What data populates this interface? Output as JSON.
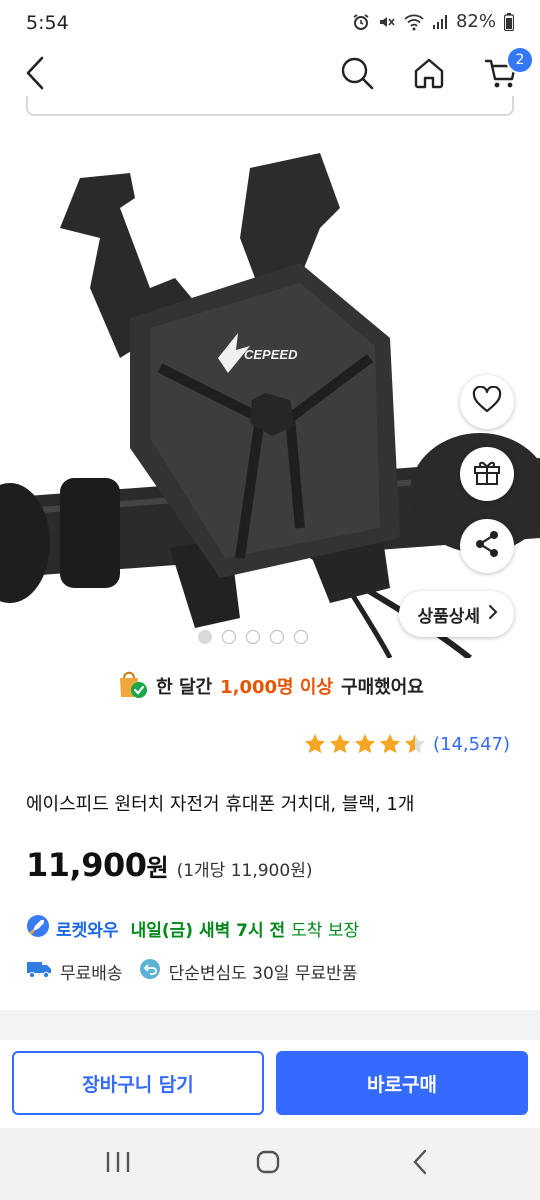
{
  "status": {
    "time": "5:54",
    "battery": "82%"
  },
  "nav": {
    "cart_count": "2"
  },
  "product": {
    "brand_logo_text": "CEPEED",
    "image_dots": 5,
    "detail_button_label": "상품상세",
    "purchase_note": {
      "prefix": "한 달간",
      "highlight": "1,000명 이상",
      "suffix": "구매했어요"
    },
    "rating": 4.5,
    "review_count": "(14,547)",
    "title": "에이스피드 원터치 자전거 휴대폰 거치대, 블랙, 1개",
    "price": "11,900",
    "price_unit": "원",
    "unit_price": "(1개당 11,900원)",
    "delivery": {
      "rocket_label": "로켓와우",
      "date_text": "내일(금) 새벽 7시 전",
      "guarantee": "도착 보장"
    },
    "perks": {
      "free_shipping": "무료배송",
      "returns": "단순변심도 30일 무료반품"
    }
  },
  "actions": {
    "add_to_cart": "장바구니 담기",
    "buy_now": "바로구매"
  },
  "colors": {
    "accent_blue": "#346aff",
    "badge_blue": "#3478f6",
    "highlight_orange": "#e85400",
    "delivery_green": "#00891a",
    "star_gold": "#f5a623"
  }
}
